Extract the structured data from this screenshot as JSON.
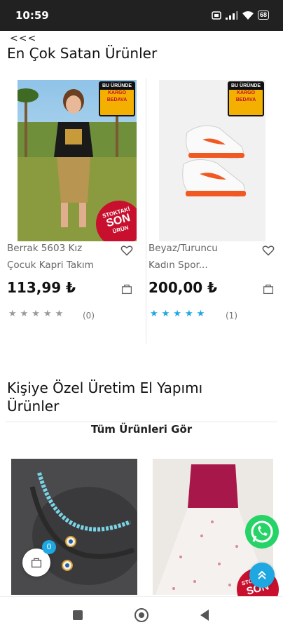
{
  "status": {
    "time": "10:59",
    "battery": "68"
  },
  "nav": {
    "back_label": "<<<"
  },
  "section1": {
    "title": "En Çok Satan Ürünler",
    "products": [
      {
        "name_line1": "Berrak 5603 Kız",
        "name_line2": "Çocuk Kapri Takım",
        "price": "113,99 ₺",
        "stars": "★★★★★",
        "rating_count": "(0)",
        "star_color": "#9a9a9a"
      },
      {
        "name_line1": "Beyaz/Turuncu",
        "name_line2": "Kadın Spor...",
        "price": "200,00 ₺",
        "stars": "★★★★★",
        "rating_count": "(1)",
        "star_color": "#1ea7e1"
      }
    ],
    "badges": {
      "cargo_line1": "BU ÜRÜNDE",
      "cargo_line2": "KARGO",
      "cargo_line3": "BEDAVA",
      "lastitem_line1": "STOKTAKİ",
      "lastitem_line2": "SON",
      "lastitem_line3": "ÜRÜN"
    }
  },
  "section2": {
    "title_line1": "Kişiye Özel Üretim El Yapımı",
    "title_line2": "Ürünler",
    "view_all": "Tüm Ürünleri Gör",
    "cart_count": "0",
    "partial_badge_line1": "STOKTAKİ",
    "partial_badge_line2": "SON"
  },
  "colors": {
    "accent": "#1ea7e1",
    "badge_red": "#c8102e",
    "whatsapp": "#25d366"
  }
}
